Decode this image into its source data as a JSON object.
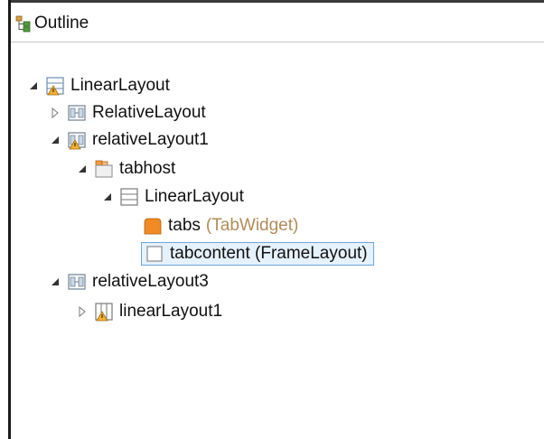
{
  "outline": {
    "title": "Outline",
    "icon": "outline-tree-icon"
  },
  "tree": [
    {
      "id": "n0",
      "label": "LinearLayout",
      "type": "",
      "icon": "linear-layout-warning-icon",
      "toggle": "expanded"
    },
    {
      "id": "n1",
      "label": "RelativeLayout",
      "type": "",
      "icon": "relative-layout-icon",
      "toggle": "collapsed"
    },
    {
      "id": "n2",
      "label": "relativeLayout1",
      "type": "",
      "icon": "relative-layout-warning-icon",
      "toggle": "expanded"
    },
    {
      "id": "n3",
      "label": "tabhost",
      "type": "",
      "icon": "tabhost-icon",
      "toggle": "expanded"
    },
    {
      "id": "n4",
      "label": "LinearLayout",
      "type": "",
      "icon": "linear-layout-icon",
      "toggle": "expanded"
    },
    {
      "id": "n5",
      "label": "tabs",
      "type": "(TabWidget)",
      "icon": "tab-widget-icon",
      "toggle": "none"
    },
    {
      "id": "n6",
      "label": "tabcontent (FrameLayout)",
      "type": "",
      "icon": "frame-layout-icon",
      "toggle": "none",
      "selected": true
    },
    {
      "id": "n7",
      "label": "relativeLayout3",
      "type": "",
      "icon": "relative-layout-icon",
      "toggle": "expanded"
    },
    {
      "id": "n8",
      "label": "linearLayout1",
      "type": "",
      "icon": "linear-layout-vertical-warning-icon",
      "toggle": "collapsed"
    }
  ]
}
